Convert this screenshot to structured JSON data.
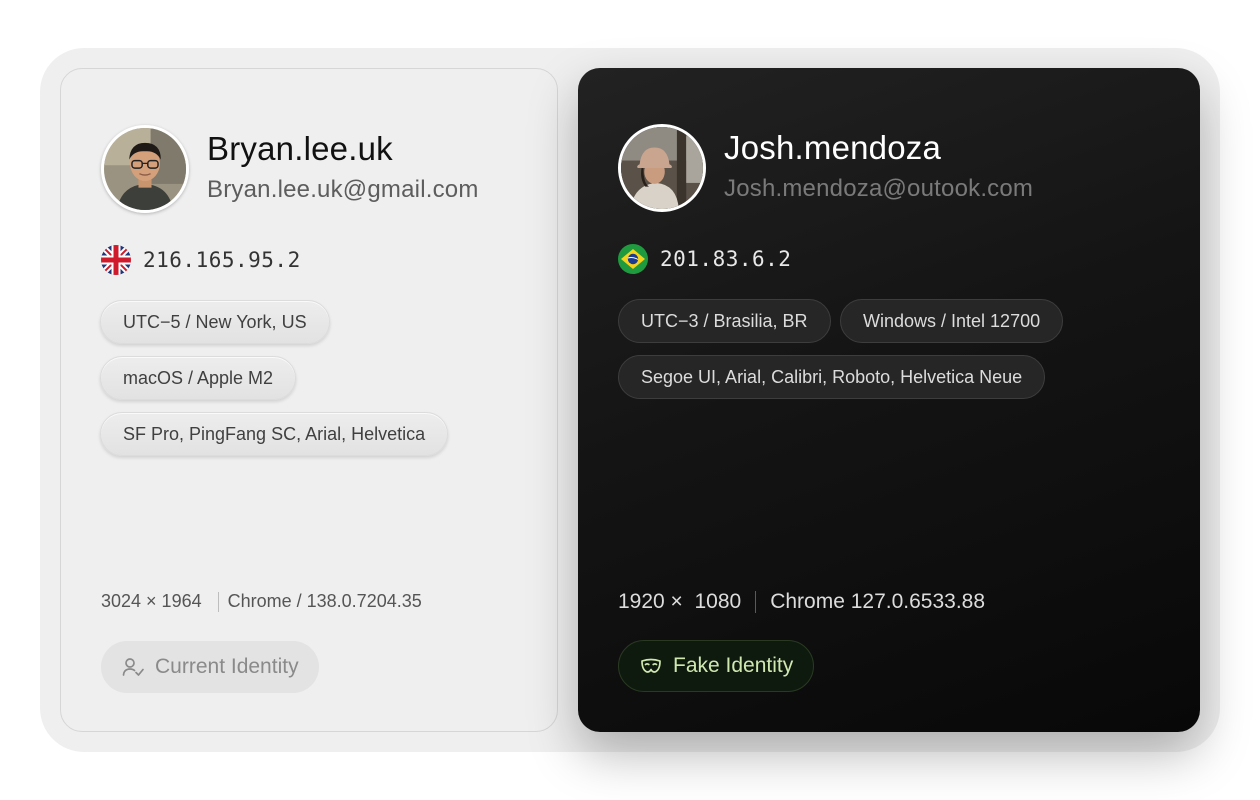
{
  "current": {
    "username": "Bryan.lee.uk",
    "email": "Bryan.lee.uk@gmail.com",
    "flag": "uk-flag-icon",
    "ip": "216.165.95.2",
    "chips": [
      "UTC−5 / New York, US",
      "macOS / Apple M2",
      "SF Pro, PingFang SC, Arial, Helvetica"
    ],
    "resolution": "3024 × 1964",
    "browser": "Chrome / 138.0.7204.35",
    "button_label": "Current Identity",
    "button_icon": "user-check-icon"
  },
  "fake": {
    "username": "Josh.mendoza",
    "email": "Josh.mendoza@outook.com",
    "flag": "brazil-flag-icon",
    "ip": "201.83.6.2",
    "chips": [
      "UTC−3 / Brasilia, BR",
      "Windows / Intel 12700",
      "Segoe UI, Arial, Calibri, Roboto, Helvetica Neue"
    ],
    "resolution": "1920 ×  1080",
    "browser": "Chrome 127.0.6533.88",
    "button_label": "Fake Identity",
    "button_icon": "mask-icon",
    "accent": "#cfe8b0"
  }
}
